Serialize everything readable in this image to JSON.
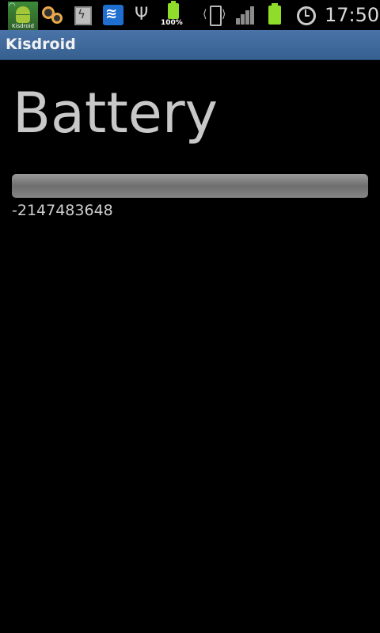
{
  "status_bar": {
    "notification_icons": [
      {
        "icon": "kisdroid-app-icon",
        "label": "Kisdroid"
      },
      {
        "icon": "gears-icon"
      },
      {
        "icon": "chip-icon"
      },
      {
        "icon": "wifi-icon"
      },
      {
        "icon": "usb-icon"
      }
    ],
    "battery_notification": {
      "icon": "battery-full-icon",
      "label": "100%"
    },
    "system_icons": [
      "vibrate-icon",
      "signal-icon",
      "battery-icon",
      "alarm-icon"
    ],
    "clock": "17:50"
  },
  "title_bar": {
    "title": "Kisdroid"
  },
  "main": {
    "heading": "Battery",
    "progress": {
      "value_fraction": 0.0
    },
    "value_text": "-2147483648"
  },
  "colors": {
    "title_bar_bg": "#3f6a9d",
    "background": "#000000",
    "heading_text": "#c8c8c8",
    "battery_green": "#8fdc2a",
    "wifi_blue": "#1f6fd1"
  }
}
